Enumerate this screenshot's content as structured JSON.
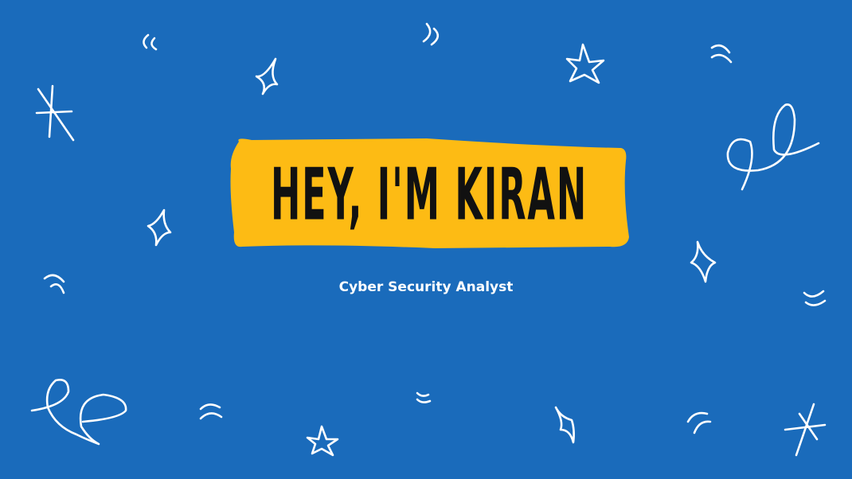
{
  "slide": {
    "headline": "HEY, I'M KIRAN",
    "subtitle": "Cyber Security Analyst"
  },
  "colors": {
    "background": "#1a6bbb",
    "highlight": "#fdbb14",
    "headline_text": "#111111",
    "subtitle_text": "#ffffff",
    "doodle": "#ffffff"
  },
  "icons": [
    "asterisk-icon",
    "star-icon",
    "sparkle-icon",
    "swirl-icon",
    "arc-icon"
  ]
}
